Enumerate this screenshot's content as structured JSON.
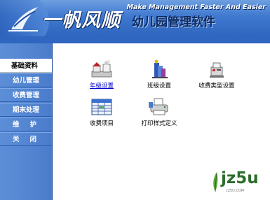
{
  "header": {
    "brand": "一帆风顺",
    "subtitle": "幼儿园管理软件",
    "slogan": "Make Management Faster And Easier"
  },
  "sidebar": {
    "items": [
      {
        "label": "基础资料",
        "active": true
      },
      {
        "label": "幼儿管理",
        "active": false
      },
      {
        "label": "收费管理",
        "active": false
      },
      {
        "label": "期末处理",
        "active": false
      },
      {
        "label": "维护",
        "active": false
      },
      {
        "label": "关闭",
        "active": false
      }
    ]
  },
  "content": {
    "tiles": [
      {
        "label": "年级设置",
        "icon": "grade-settings-icon",
        "link": true
      },
      {
        "label": "班级设置",
        "icon": "class-settings-icon",
        "link": false
      },
      {
        "label": "收费类型设置",
        "icon": "fee-type-settings-icon",
        "link": false
      },
      {
        "label": "收费项目",
        "icon": "fee-items-icon",
        "link": false
      },
      {
        "label": "打印样式定义",
        "icon": "print-style-icon",
        "link": false
      }
    ]
  },
  "watermark": {
    "text": "jz5u",
    "sub": "JZ5U.COM"
  }
}
